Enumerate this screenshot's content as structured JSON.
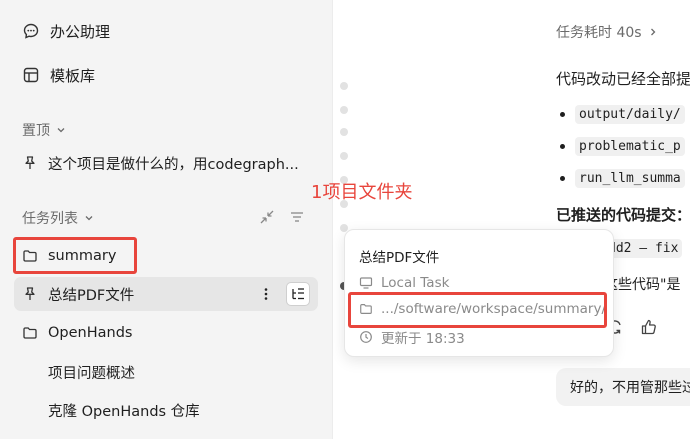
{
  "sidebar": {
    "nav": [
      {
        "label": "办公助理",
        "icon": "chat-bubble-icon"
      },
      {
        "label": "模板库",
        "icon": "template-icon"
      }
    ],
    "pinned_label": "置顶",
    "pinned_items": [
      {
        "label": "这个项目是做什么的，用codegraph...",
        "icon": "pin-icon"
      }
    ],
    "tasks_label": "任务列表",
    "tasks": [
      {
        "label": "summary",
        "icon": "folder-icon"
      },
      {
        "label": "总结PDF文件",
        "icon": "pin-icon",
        "active": true
      },
      {
        "label": "OpenHands",
        "icon": "folder-icon"
      },
      {
        "label": "项目问题概述"
      },
      {
        "label": "克隆 OpenHands 仓库"
      }
    ]
  },
  "annotation": {
    "text": "1项目文件夹"
  },
  "popover": {
    "title": "总结PDF文件",
    "location_type": "Local Task",
    "path": ".../software/workspace/summary/",
    "updated": "更新于 18:33"
  },
  "main": {
    "task_time": "任务耗时 40s",
    "summary": "代码改动已经全部提",
    "bullets": [
      "output/daily/",
      "problematic_p",
      "run_llm_summa"
    ],
    "pushed_label": "已推送的代码提交：",
    "commit_text": "dd2 — fix",
    "quote_text": "这些代码\"是",
    "bubble": "好的，不用管那些过"
  },
  "colors": {
    "accent_red": "#e8453c",
    "sidebar_bg": "#f4f4f4",
    "active_row": "#e6e6e6"
  }
}
